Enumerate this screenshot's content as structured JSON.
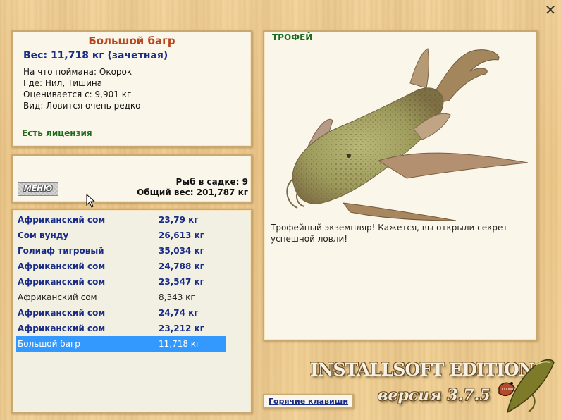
{
  "window": {
    "close_icon": "close-icon"
  },
  "catch_info": {
    "fish_name": "Большой багр",
    "weight": "Вес: 11,718 кг (зачетная)",
    "bait": "На что поймана: Окорок",
    "location": "Где: Нил, Тишина",
    "valued_from": "Оценивается с: 9,901 кг",
    "rarity": "Вид: Ловится очень редко",
    "license": "Есть лицензия"
  },
  "keepnet": {
    "menu_label": "МЕНЮ",
    "fish_count": "Рыб в садке: 9",
    "total_weight": "Общий вес: 201,787 кг"
  },
  "fish_list": [
    {
      "name": "Африканский сом",
      "weight": "23,79 кг",
      "style": "bold"
    },
    {
      "name": "Сом вунду",
      "weight": "26,613 кг",
      "style": "bold"
    },
    {
      "name": "Голиаф тигровый",
      "weight": "35,034 кг",
      "style": "bold"
    },
    {
      "name": "Африканский сом",
      "weight": "24,788 кг",
      "style": "bold"
    },
    {
      "name": "Африканский сом",
      "weight": "23,547 кг",
      "style": "bold"
    },
    {
      "name": "Африканский сом",
      "weight": "8,343 кг",
      "style": "plain"
    },
    {
      "name": "Африканский сом",
      "weight": "24,74 кг",
      "style": "bold"
    },
    {
      "name": "Африканский сом",
      "weight": "23,212 кг",
      "style": "bold"
    },
    {
      "name": "Большой багр",
      "weight": "11,718 кг",
      "style": "selected"
    }
  ],
  "trophy": {
    "label": "ТРОФЕЙ",
    "description": "Трофейный экземпляр! Кажется, вы открыли секрет успешной ловли!"
  },
  "footer": {
    "brand": "INSTALLSOFT EDITION",
    "version": "версия 3.7.5",
    "hotkeys_label": "Горячие клавиши"
  },
  "colors": {
    "title": "#b8441c",
    "accent": "#182b86",
    "license": "#1d6b1d",
    "selection": "#3399ff"
  }
}
